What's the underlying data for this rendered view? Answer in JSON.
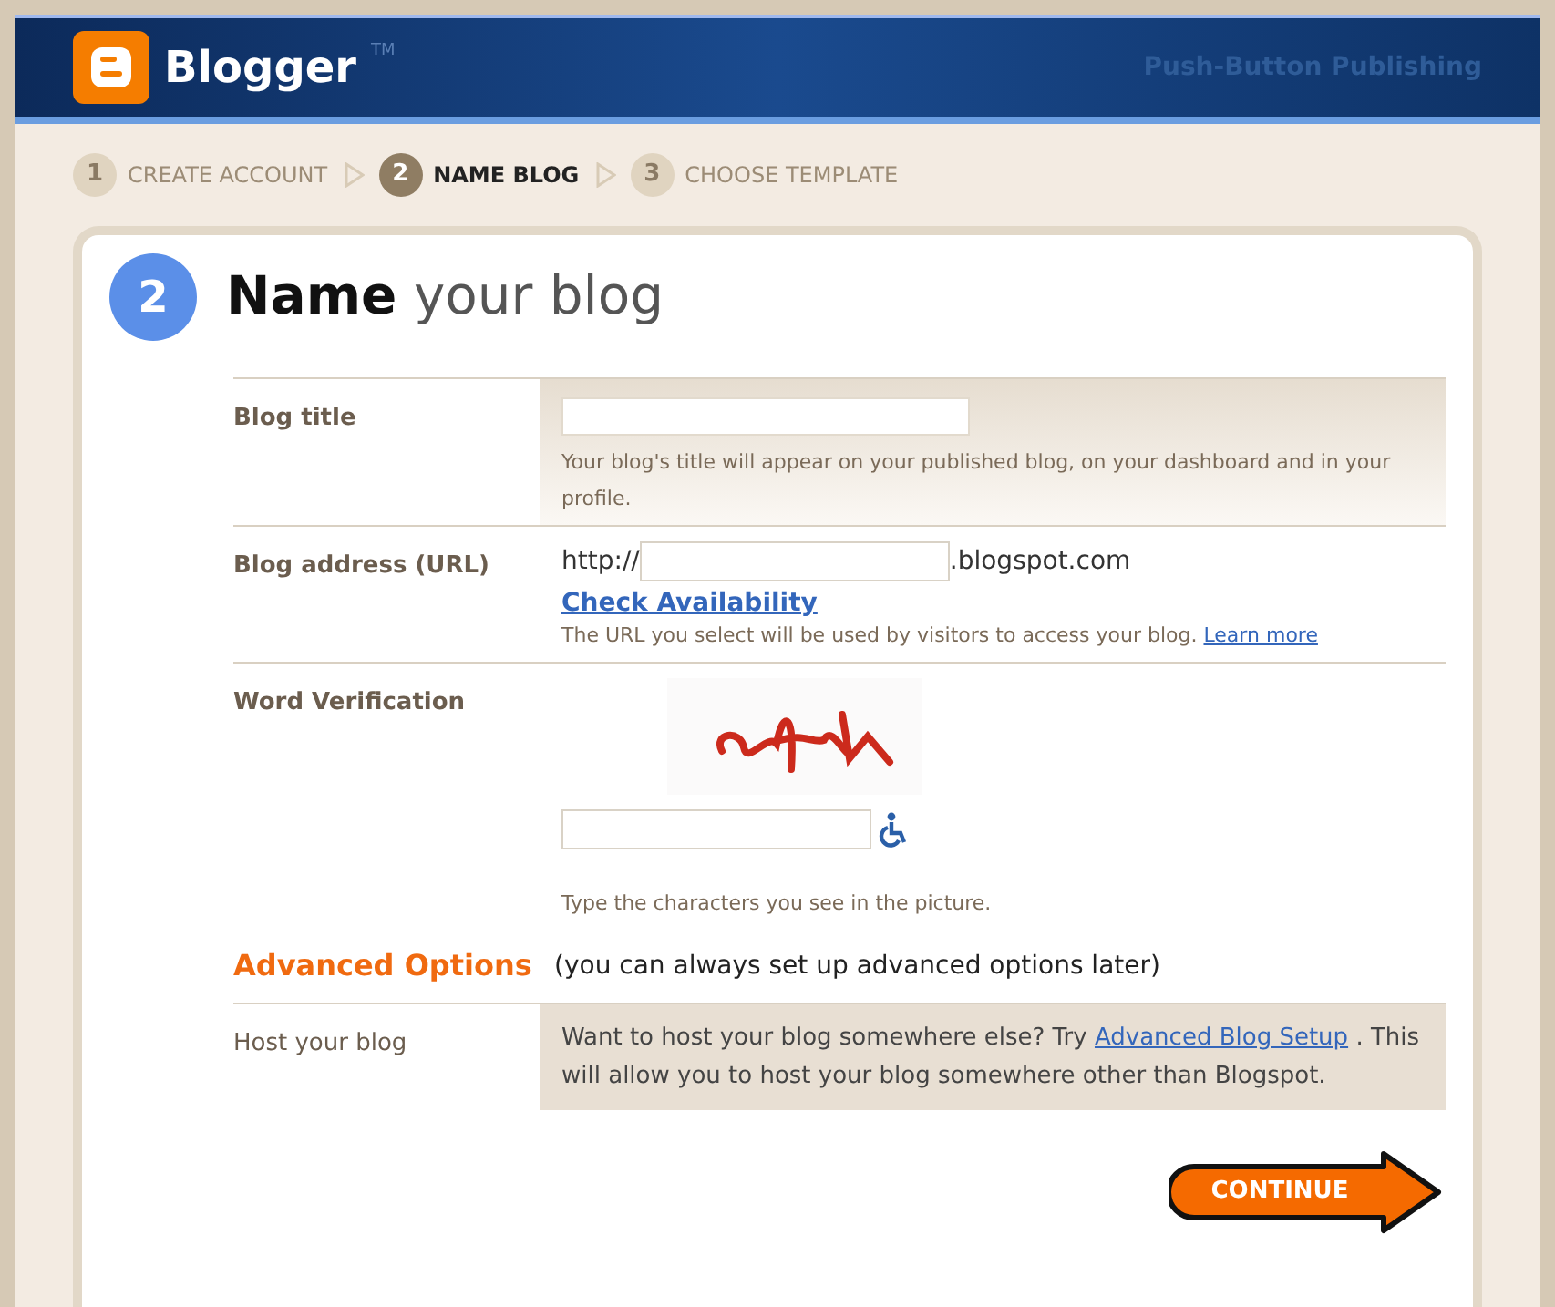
{
  "header": {
    "logo_text": "Blogger",
    "trademark": "TM",
    "tagline": "Push-Button Publishing"
  },
  "steps": [
    {
      "number": "1",
      "label": "CREATE ACCOUNT",
      "selected": false
    },
    {
      "number": "2",
      "label": "NAME BLOG",
      "selected": true
    },
    {
      "number": "3",
      "label": "CHOOSE TEMPLATE",
      "selected": false
    }
  ],
  "heading": {
    "step_number": "2",
    "text": "**Name** your blog"
  },
  "fields": [
    {
      "kind": "title",
      "label": "Blog title",
      "help": "Your blog's title will appear on your published blog, on your dashboard and in your profile."
    },
    {
      "kind": "url",
      "label": "Blog address (URL)",
      "prefix": "http://",
      "suffix": ".blogspot.com",
      "check_link": "Check Availability",
      "help": "The URL you select will be used by visitors to access your blog.",
      "help_link": "Learn more"
    },
    {
      "kind": "captcha",
      "label": "Word Verification",
      "help": "Type the characters you see in the picture."
    }
  ],
  "advanced": {
    "title": "Advanced Options",
    "note": "(you can always set up advanced options later)"
  },
  "host": {
    "label": "Host your blog",
    "text_before": "Want to host your blog somewhere else? Try",
    "link": "Advanced Blog Setup",
    "text_after": ". This will allow you to host your blog somewhere other than Blogspot."
  },
  "continue_button": "CONTINUE"
}
